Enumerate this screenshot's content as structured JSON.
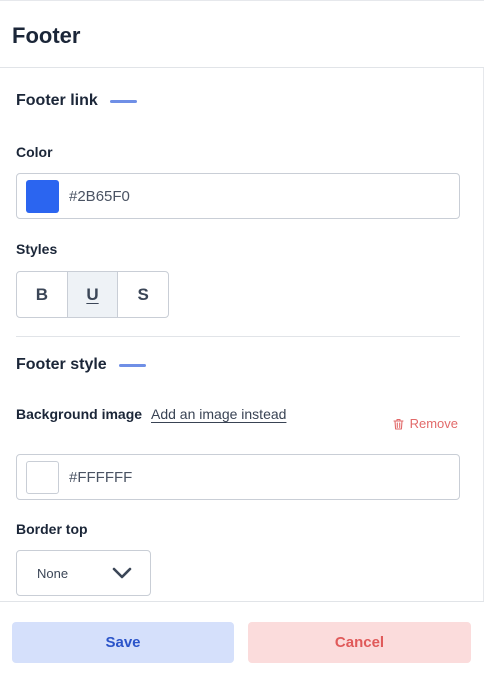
{
  "panel": {
    "title": "Footer"
  },
  "footer_link": {
    "heading": "Footer link",
    "color_label": "Color",
    "color_value": "#2B65F0",
    "swatch_color": "#2B65F0",
    "styles_label": "Styles",
    "styles": [
      {
        "label": "B",
        "active": false
      },
      {
        "label": "U",
        "active": true
      },
      {
        "label": "S",
        "active": false
      }
    ]
  },
  "footer_style": {
    "heading": "Footer style",
    "background_label": "Background image",
    "add_image_link": "Add an image instead",
    "remove_label": "Remove",
    "color_value": "#FFFFFF",
    "swatch_color": "#FFFFFF",
    "border_top_label": "Border top",
    "border_top_value": "None"
  },
  "actions": {
    "save_label": "Save",
    "cancel_label": "Cancel"
  },
  "colors": {
    "accent": "#2B54C9",
    "danger": "#E05A5A"
  }
}
